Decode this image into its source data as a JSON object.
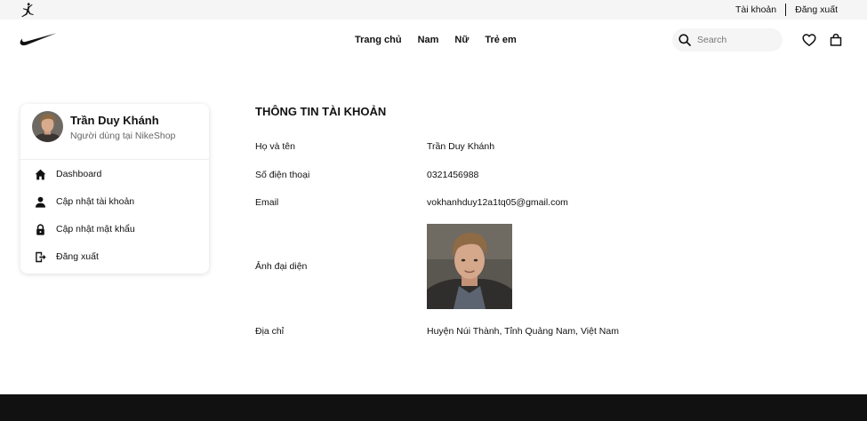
{
  "topbar": {
    "brand_icon": "jordan-jumpman-icon",
    "account_link": "Tài khoản",
    "logout_link": "Đăng xuất"
  },
  "navbar": {
    "logo_icon": "nike-swoosh-icon",
    "menu": [
      "Trang chủ",
      "Nam",
      "Nữ",
      "Trẻ em"
    ],
    "search_placeholder": "Search",
    "icons": [
      "search-icon",
      "heart-icon",
      "bag-icon"
    ]
  },
  "sidebar": {
    "name": "Trần Duy Khánh",
    "subtitle": "Người dùng tại NikeShop",
    "items": [
      {
        "label": "Dashboard",
        "icon": "home-icon"
      },
      {
        "label": "Cập nhật tài khoản",
        "icon": "user-icon"
      },
      {
        "label": "Cập nhật mật khẩu",
        "icon": "lock-icon"
      },
      {
        "label": "Đăng xuất",
        "icon": "logout-icon"
      }
    ]
  },
  "account": {
    "title": "THÔNG TIN TÀI KHOẢN",
    "fullname_label": "Họ và tên",
    "fullname": "Trần Duy Khánh",
    "phone_label": "Số điện thoại",
    "phone": "0321456988",
    "email_label": "Email",
    "email": "vokhanhduy12a1tq05@gmail.com",
    "avatar_label": "Ảnh đại diện",
    "address_label": "Địa chỉ",
    "address": "Huyện Núi Thành, Tỉnh Quảng Nam, Việt Nam"
  },
  "colors": {
    "topbar_bg": "#f5f5f5",
    "footer_bg": "#111111",
    "text": "#111111",
    "muted": "#666666"
  }
}
